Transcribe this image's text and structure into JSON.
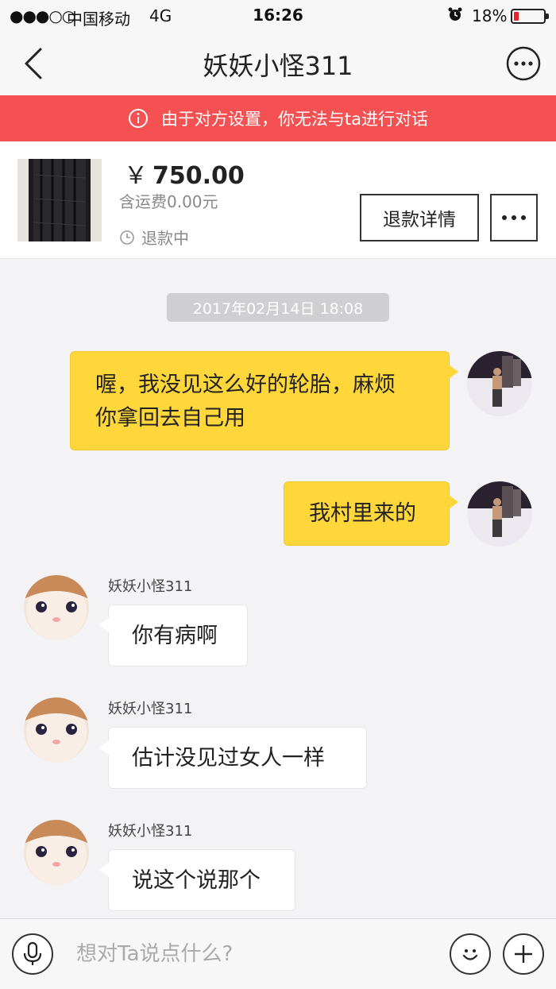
{
  "status_bar": {
    "signal": "●●●○○",
    "carrier": "中国移动",
    "network": "4G",
    "time": "16:26",
    "battery_percent": "18%",
    "battery_level": 0.18,
    "battery_color": "#e8232d"
  },
  "nav": {
    "title": "妖妖小怪311",
    "back_icon": "chevron-left-icon",
    "more_icon": "ellipsis-circle-icon"
  },
  "warning": {
    "text": "由于对方设置，你无法与ta进行对话",
    "color": "#f55152"
  },
  "product": {
    "currency": "￥",
    "price": "750.00",
    "shipping": "含运费0.00元",
    "status": "退款中",
    "refund_button": "退款详情"
  },
  "chat": {
    "timestamp": "2017年02月14日 18:08",
    "messages": [
      {
        "from": "me",
        "lines": [
          "喔，我没见这么好的轮胎，麻烦",
          "你拿回去自己用"
        ]
      },
      {
        "from": "me",
        "lines": [
          "我村里来的"
        ]
      },
      {
        "from": "other",
        "name": "妖妖小怪311",
        "lines": [
          "你有病啊"
        ]
      },
      {
        "from": "other",
        "name": "妖妖小怪311",
        "lines": [
          "估计没见过女人一样"
        ]
      },
      {
        "from": "other",
        "name": "妖妖小怪311",
        "lines": [
          "说这个说那个"
        ]
      }
    ]
  },
  "input": {
    "placeholder": "想对Ta说点什么?"
  },
  "colors": {
    "outgoing_bubble": "#ffd73a",
    "incoming_bubble": "#ffffff",
    "background": "#f3f3f5"
  }
}
